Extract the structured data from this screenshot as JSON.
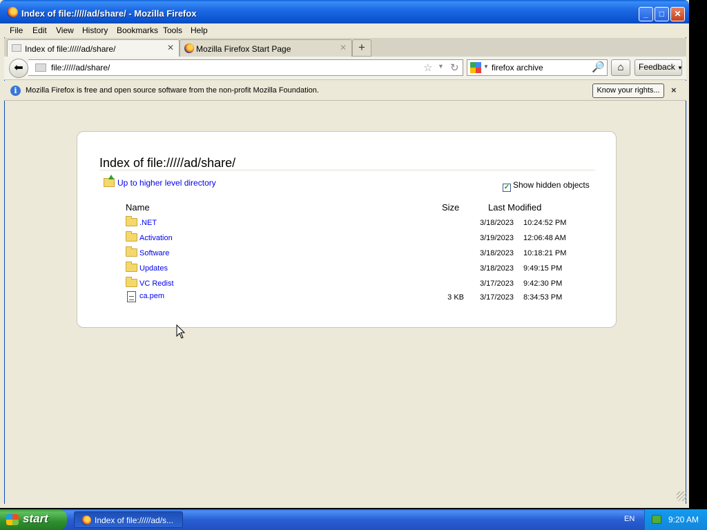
{
  "window": {
    "title": "Index of file://///ad/share/ - Mozilla Firefox",
    "minimize_icon": "minimize-icon",
    "maximize_icon": "maximize-icon",
    "close_icon": "close-icon"
  },
  "menu": [
    "File",
    "Edit",
    "View",
    "History",
    "Bookmarks",
    "Tools",
    "Help"
  ],
  "tabs": [
    {
      "label": "Index of file://///ad/share/",
      "icon": "page-icon",
      "active": true
    },
    {
      "label": "Mozilla Firefox Start Page",
      "icon": "firefox-icon",
      "active": false
    }
  ],
  "newtab_label": "+",
  "navbar": {
    "url": "file://///ad/share/",
    "search_value": "firefox archive",
    "feedback_label": "Feedback"
  },
  "infobar": {
    "message": "Mozilla Firefox is free and open source software from the non-profit Mozilla Foundation.",
    "button_label": "Know your rights...",
    "close_label": "×"
  },
  "listing": {
    "heading": "Index of file://///ad/share/",
    "up_link": "Up to higher level directory",
    "show_hidden_label": "Show hidden objects",
    "show_hidden_checked": true,
    "columns": {
      "name": "Name",
      "size": "Size",
      "modified": "Last Modified"
    },
    "entries": [
      {
        "name": ".NET",
        "type": "folder",
        "size": "",
        "date": "3/18/2023",
        "time": "10:24:52 PM"
      },
      {
        "name": "Activation",
        "type": "folder",
        "size": "",
        "date": "3/19/2023",
        "time": "12:06:48 AM"
      },
      {
        "name": "Software",
        "type": "folder",
        "size": "",
        "date": "3/18/2023",
        "time": "10:18:21 PM"
      },
      {
        "name": "Updates",
        "type": "folder",
        "size": "",
        "date": "3/18/2023",
        "time": "9:49:15 PM"
      },
      {
        "name": "VC Redist",
        "type": "folder",
        "size": "",
        "date": "3/17/2023",
        "time": "9:42:30 PM"
      },
      {
        "name": "ca.pem",
        "type": "file",
        "size": "3 KB",
        "date": "3/17/2023",
        "time": "8:34:53 PM"
      }
    ]
  },
  "taskbar": {
    "start_label": "start",
    "task_label": "Index of file://///ad/s...",
    "language": "EN",
    "clock": "9:20 AM"
  }
}
